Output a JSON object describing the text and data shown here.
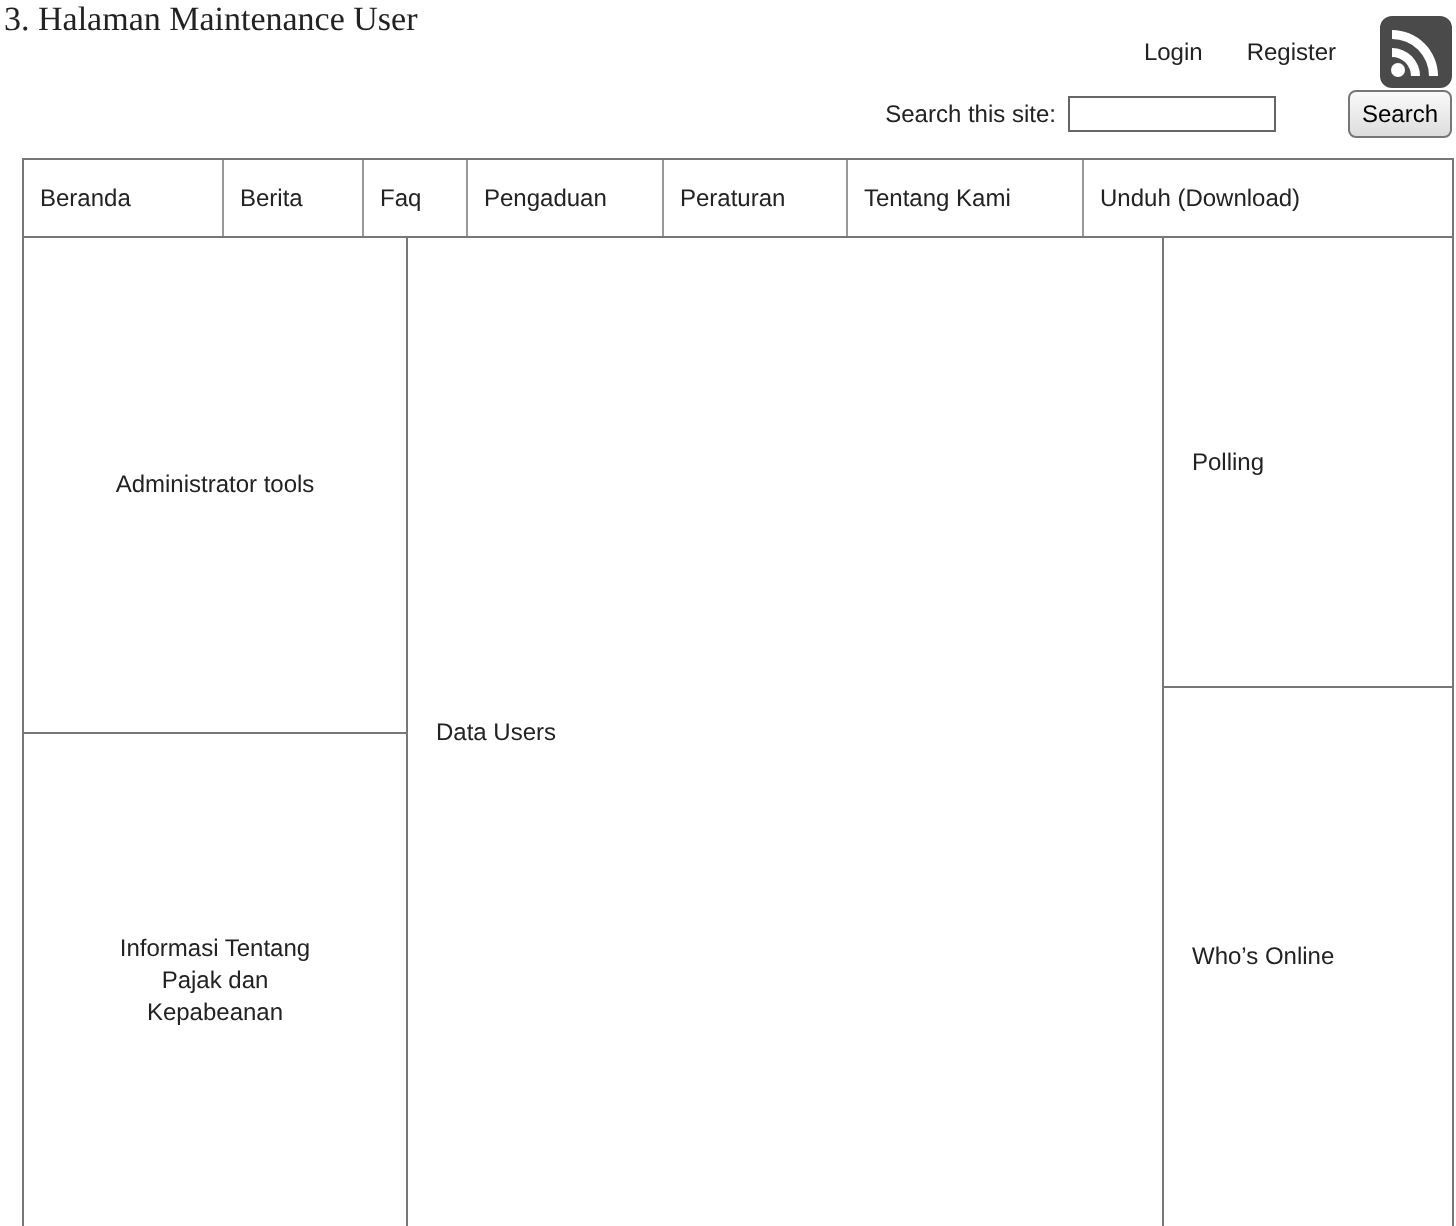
{
  "document_heading": "3. Halaman Maintenance User",
  "header": {
    "links": [
      "Login",
      "Register"
    ],
    "search": {
      "label": "Search this site:",
      "button": "Search"
    }
  },
  "nav": [
    "Beranda",
    "Berita",
    "Faq",
    "Pengaduan",
    "Peraturan",
    "Tentang Kami",
    "Unduh (Download)"
  ],
  "left_panels": [
    "Administrator tools",
    "Informasi Tentang Pajak dan Kepabeanan"
  ],
  "main_panel": "Data Users",
  "right_panels": [
    "Polling",
    "Who’s Online"
  ]
}
